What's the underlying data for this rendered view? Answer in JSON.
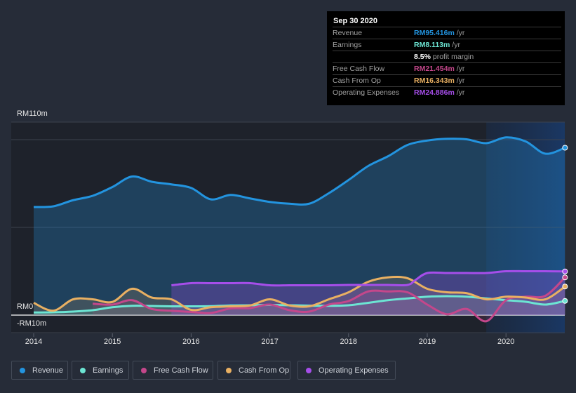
{
  "tooltip": {
    "date": "Sep 30 2020",
    "rows": [
      {
        "label": "Revenue",
        "value": "RM95.416m",
        "unit": " /yr",
        "color": "#2394df"
      },
      {
        "label": "Earnings",
        "value": "RM8.113m",
        "unit": " /yr",
        "color": "#6ce5d3"
      },
      {
        "label": "Free Cash Flow",
        "value": "RM21.454m",
        "unit": " /yr",
        "color": "#c4478b"
      },
      {
        "label": "Cash From Op",
        "value": "RM16.343m",
        "unit": " /yr",
        "color": "#e9b062"
      },
      {
        "label": "Operating Expenses",
        "value": "RM24.886m",
        "unit": " /yr",
        "color": "#a64eea"
      }
    ],
    "margin_value": "8.5%",
    "margin_label": " profit margin"
  },
  "chart_data": {
    "type": "area",
    "title": "",
    "xlabel": "",
    "ylabel": "",
    "y_tick_labels": [
      "RM110m",
      "RM0",
      "-RM10m"
    ],
    "x_tick_labels": [
      "2014",
      "2015",
      "2016",
      "2017",
      "2018",
      "2019",
      "2020"
    ],
    "ylim": [
      -10,
      110
    ],
    "xlim": [
      2014.0,
      2020.75
    ],
    "gridlines_at": [
      110,
      100,
      50,
      0,
      -10
    ],
    "highlight_from": 2019.75,
    "legend_position": "bottom",
    "series": [
      {
        "name": "Revenue",
        "color": "#2394df",
        "x": [
          2014.0,
          2014.25,
          2014.5,
          2014.75,
          2015.0,
          2015.25,
          2015.5,
          2015.75,
          2016.0,
          2016.25,
          2016.5,
          2016.75,
          2017.0,
          2017.25,
          2017.5,
          2017.75,
          2018.0,
          2018.25,
          2018.5,
          2018.75,
          2019.0,
          2019.25,
          2019.5,
          2019.75,
          2020.0,
          2020.25,
          2020.5,
          2020.75
        ],
        "values": [
          61.6,
          62.0,
          65.5,
          68.0,
          73.0,
          79.0,
          76.0,
          74.5,
          72.5,
          66.0,
          68.5,
          66.5,
          64.5,
          63.5,
          63.5,
          69.5,
          77.0,
          85.0,
          90.5,
          97.0,
          99.5,
          100.5,
          100.2,
          98.0,
          101.3,
          99.0,
          92.0,
          95.4
        ]
      },
      {
        "name": "Earnings",
        "color": "#6ce5d3",
        "x": [
          2014.0,
          2014.25,
          2014.5,
          2014.75,
          2015.0,
          2015.25,
          2015.5,
          2015.75,
          2016.0,
          2016.25,
          2016.5,
          2016.75,
          2017.0,
          2017.25,
          2017.5,
          2017.75,
          2018.0,
          2018.25,
          2018.5,
          2018.75,
          2019.0,
          2019.25,
          2019.5,
          2019.75,
          2020.0,
          2020.25,
          2020.5,
          2020.75
        ],
        "values": [
          1.5,
          1.6,
          2.0,
          2.8,
          4.5,
          5.3,
          5.2,
          5.0,
          5.0,
          5.1,
          5.5,
          5.6,
          5.8,
          5.6,
          5.4,
          5.3,
          5.6,
          7.0,
          8.5,
          9.5,
          10.5,
          10.8,
          10.5,
          9.5,
          8.5,
          7.6,
          6.0,
          8.1
        ]
      },
      {
        "name": "Free Cash Flow",
        "color": "#c4478b",
        "x": [
          2014.75,
          2015.0,
          2015.25,
          2015.5,
          2015.75,
          2016.0,
          2016.25,
          2016.5,
          2016.75,
          2017.0,
          2017.25,
          2017.5,
          2017.75,
          2018.0,
          2018.25,
          2018.5,
          2018.75,
          2019.0,
          2019.25,
          2019.5,
          2019.75,
          2020.0,
          2020.25,
          2020.5,
          2020.75
        ],
        "values": [
          6.5,
          6.0,
          8.5,
          3.5,
          2.5,
          1.8,
          1.2,
          3.8,
          4.0,
          6.0,
          2.8,
          2.0,
          6.0,
          8.0,
          13.5,
          13.5,
          13.0,
          6.0,
          0.5,
          3.5,
          -3.5,
          8.5,
          10.5,
          11.0,
          21.5
        ]
      },
      {
        "name": "Cash From Op",
        "color": "#e9b062",
        "x": [
          2014.0,
          2014.25,
          2014.5,
          2014.75,
          2015.0,
          2015.25,
          2015.5,
          2015.75,
          2016.0,
          2016.25,
          2016.5,
          2016.75,
          2017.0,
          2017.25,
          2017.5,
          2017.75,
          2018.0,
          2018.25,
          2018.5,
          2018.75,
          2019.0,
          2019.25,
          2019.5,
          2019.75,
          2020.0,
          2020.25,
          2020.5,
          2020.75
        ],
        "values": [
          7.0,
          2.5,
          9.0,
          9.0,
          7.5,
          15.0,
          10.0,
          9.0,
          3.0,
          4.5,
          5.0,
          5.5,
          9.0,
          5.5,
          5.0,
          9.0,
          13.0,
          19.0,
          21.5,
          21.0,
          15.0,
          13.0,
          12.5,
          9.0,
          10.5,
          10.0,
          9.0,
          16.3
        ]
      },
      {
        "name": "Operating Expenses",
        "color": "#a64eea",
        "x": [
          2015.75,
          2016.0,
          2016.25,
          2016.5,
          2016.75,
          2017.0,
          2017.25,
          2017.5,
          2017.75,
          2018.0,
          2018.25,
          2018.5,
          2018.75,
          2018.85,
          2019.0,
          2019.25,
          2019.5,
          2019.75,
          2020.0,
          2020.25,
          2020.5,
          2020.75
        ],
        "values": [
          17.0,
          18.2,
          18.2,
          18.2,
          18.2,
          17.0,
          17.0,
          17.0,
          17.0,
          17.2,
          17.2,
          17.2,
          17.2,
          20.0,
          24.0,
          24.0,
          24.0,
          24.0,
          25.0,
          25.0,
          25.0,
          24.9
        ]
      }
    ]
  }
}
